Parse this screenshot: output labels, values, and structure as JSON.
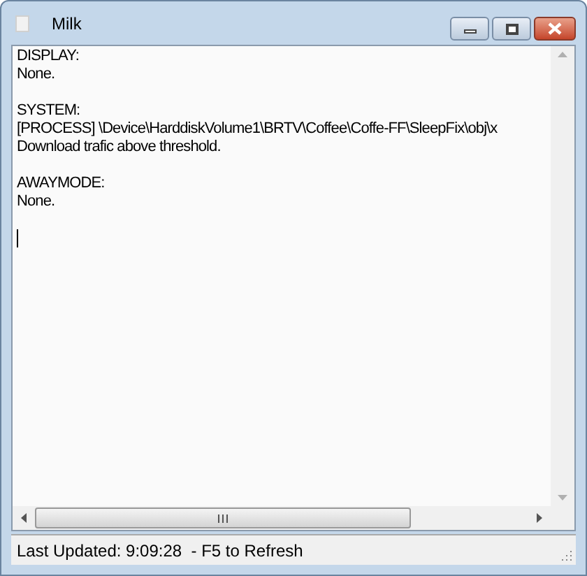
{
  "window": {
    "title": "Milk"
  },
  "sections": [
    {
      "heading": "DISPLAY:",
      "lines": [
        "None."
      ]
    },
    {
      "heading": "SYSTEM:",
      "lines": [
        "[PROCESS] \\Device\\HarddiskVolume1\\BRTV\\Coffee\\Coffe-FF\\SleepFix\\obj\\x",
        "Download trafic above threshold."
      ]
    },
    {
      "heading": "AWAYMODE:",
      "lines": [
        "None."
      ]
    }
  ],
  "status_bar": "Last Updated: 9:09:28  - F5 to Refresh"
}
